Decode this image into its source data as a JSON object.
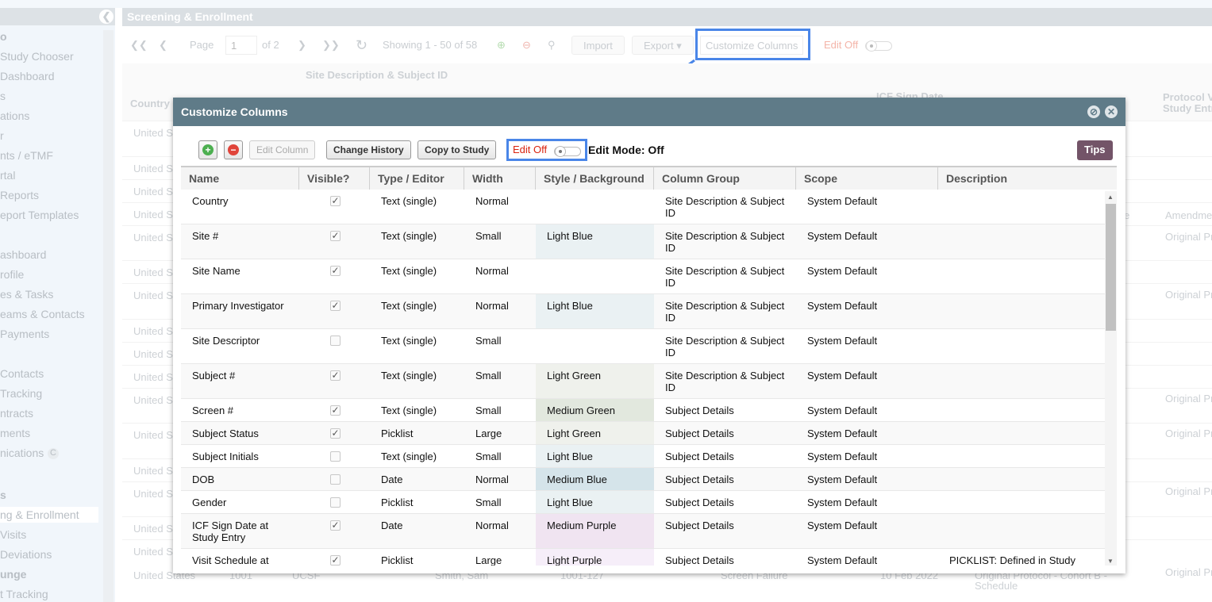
{
  "sidebar": {
    "items": [
      {
        "label": "o",
        "bold": true
      },
      {
        "label": "Study Chooser"
      },
      {
        "label": " Dashboard"
      },
      {
        "label": "s"
      },
      {
        "label": "ations"
      },
      {
        "label": "r"
      },
      {
        "label": "nts / eTMF"
      },
      {
        "label": "rtal"
      },
      {
        "label": "Reports"
      },
      {
        "label": "eport Templates"
      },
      {
        "label": "ashboard"
      },
      {
        "label": "rofile"
      },
      {
        "label": "es & Tasks"
      },
      {
        "label": "eams & Contacts"
      },
      {
        "label": "Payments"
      },
      {
        "label": "Contacts"
      },
      {
        "label": "Tracking"
      },
      {
        "label": "ntracts"
      },
      {
        "label": "ments"
      },
      {
        "label": "nications"
      },
      {
        "label": "s",
        "bold": true
      },
      {
        "label": "ng & Enrollment",
        "selected": true
      },
      {
        "label": "Visits"
      },
      {
        "label": " Deviations"
      },
      {
        "label": "unge",
        "bold": true
      },
      {
        "label": "t Tracking"
      }
    ],
    "badge": "C"
  },
  "page": {
    "title": "Screening & Enrollment",
    "pager": {
      "page_label": "Page",
      "page_value": "1",
      "of_label": "of 2",
      "showing": "Showing 1 - 50 of 58"
    },
    "import_label": "Import",
    "export_label": "Export",
    "customize_label": "Customize Columns",
    "edit_label": "Edit Off",
    "group_header": "Site Description & Subject ID",
    "col_country": "Country",
    "col_icf": "ICF Sign Date",
    "col_protocol": "Protocol V\nStudy Entr",
    "bg_cells": {
      "country": "United S",
      "last_country": "United States",
      "site": "1001",
      "site_name": "UCSF",
      "pi": "Smith, Sam",
      "subject": "1001-127",
      "status": "Screen Failure",
      "date": "10 Feb 2022",
      "protocol": "Original Protocol - Cohort B -",
      "schedule": "Schedule",
      "amend": "Amendme",
      "orig": "Original Pr",
      "ule": "ule"
    }
  },
  "modal": {
    "title": "Customize Columns",
    "toolbar": {
      "edit_column": "Edit Column",
      "change_history": "Change History",
      "copy_to_study": "Copy to Study",
      "edit_off": "Edit Off",
      "edit_mode": "Edit Mode: Off",
      "tips": "Tips"
    },
    "columns": [
      "Name",
      "Visible?",
      "Type / Editor",
      "Width",
      "Style / Background",
      "Column Group",
      "Scope",
      "Description"
    ],
    "rows": [
      {
        "name": "Country",
        "visible": true,
        "type": "Text (single)",
        "width": "Normal",
        "style": "",
        "group": "Site Description & Subject ID",
        "scope": "System Default",
        "desc": ""
      },
      {
        "name": "Site #",
        "visible": true,
        "type": "Text (single)",
        "width": "Small",
        "style": "Light Blue",
        "group": "Site Description & Subject ID",
        "scope": "System Default",
        "desc": ""
      },
      {
        "name": "Site Name",
        "visible": true,
        "type": "Text (single)",
        "width": "Normal",
        "style": "",
        "group": "Site Description & Subject ID",
        "scope": "System Default",
        "desc": ""
      },
      {
        "name": "Primary Investigator",
        "visible": true,
        "type": "Text (single)",
        "width": "Normal",
        "style": "Light Blue",
        "group": "Site Description & Subject ID",
        "scope": "System Default",
        "desc": ""
      },
      {
        "name": "Site Descriptor",
        "visible": false,
        "type": "Text (single)",
        "width": "Small",
        "style": "",
        "group": "Site Description & Subject ID",
        "scope": "System Default",
        "desc": ""
      },
      {
        "name": "Subject #",
        "visible": true,
        "type": "Text (single)",
        "width": "Small",
        "style": "Light Green",
        "group": "Site Description & Subject ID",
        "scope": "System Default",
        "desc": ""
      },
      {
        "name": "Screen #",
        "visible": true,
        "type": "Text (single)",
        "width": "Small",
        "style": "Medium Green",
        "group": "Subject Details",
        "scope": "System Default",
        "desc": ""
      },
      {
        "name": "Subject Status",
        "visible": true,
        "type": "Picklist",
        "width": "Large",
        "style": "Light Green",
        "group": "Subject Details",
        "scope": "System Default",
        "desc": ""
      },
      {
        "name": "Subject Initials",
        "visible": false,
        "type": "Text (single)",
        "width": "Small",
        "style": "Light Blue",
        "group": "Subject Details",
        "scope": "System Default",
        "desc": ""
      },
      {
        "name": "DOB",
        "visible": false,
        "type": "Date",
        "width": "Normal",
        "style": "Medium Blue",
        "group": "Subject Details",
        "scope": "System Default",
        "desc": ""
      },
      {
        "name": "Gender",
        "visible": false,
        "type": "Picklist",
        "width": "Small",
        "style": "Light Blue",
        "group": "Subject Details",
        "scope": "System Default",
        "desc": ""
      },
      {
        "name": "ICF Sign Date at Study Entry",
        "visible": true,
        "type": "Date",
        "width": "Normal",
        "style": "Medium Purple",
        "group": "Subject Details",
        "scope": "System Default",
        "desc": ""
      },
      {
        "name": "Visit Schedule at",
        "visible": true,
        "type": "Picklist",
        "width": "Large",
        "style": "Light Purple",
        "group": "Subject Details",
        "scope": "System Default",
        "desc": "PICKLIST: Defined in Study"
      }
    ]
  },
  "colors": {
    "modal_header": "#5f7b88",
    "tips": "#735468",
    "highlight": "#4a86e8",
    "edit_off": "#d9230f",
    "styles": {
      "Light Blue": "#eaf1f3",
      "Light Green": "#eff1ec",
      "Medium Green": "#e2e8de",
      "Medium Blue": "#d5e4ea",
      "Medium Purple": "#f0e4f1",
      "Light Purple": "#f6eef9"
    }
  }
}
